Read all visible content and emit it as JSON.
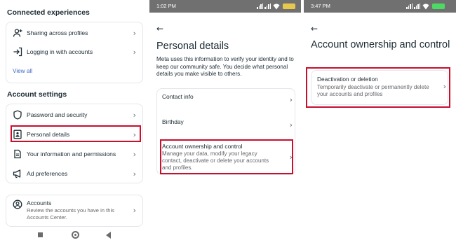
{
  "panel1": {
    "connected_heading": "Connected experiences",
    "connected_items": [
      {
        "label": "Sharing across profiles",
        "icon": "person-add-icon"
      },
      {
        "label": "Logging in with accounts",
        "icon": "login-arrow-icon"
      }
    ],
    "view_all": "View all",
    "settings_heading": "Account settings",
    "settings_items": [
      {
        "label": "Password and security",
        "icon": "shield-icon"
      },
      {
        "label": "Personal details",
        "icon": "id-card-icon",
        "highlighted": true
      },
      {
        "label": "Your information and permissions",
        "icon": "document-icon"
      },
      {
        "label": "Ad preferences",
        "icon": "megaphone-icon"
      }
    ],
    "accounts": {
      "title": "Accounts",
      "description": "Review the accounts you have in this Accounts Center.",
      "icon": "account-circle-icon"
    },
    "chevron": "›"
  },
  "panel2": {
    "time": "1:02 PM",
    "back": "←",
    "title": "Personal details",
    "description": "Meta uses this information to verify your identity and to keep our community safe. You decide what personal details you make visible to others.",
    "items": [
      {
        "label": "Contact info"
      },
      {
        "label": "Birthday"
      },
      {
        "label": "Account ownership and control",
        "sub": "Manage your data, modify your legacy contact, deactivate or delete your accounts and profiles.",
        "highlighted": true
      }
    ],
    "chevron": "›"
  },
  "panel3": {
    "time": "3:47 PM",
    "back": "←",
    "title": "Account ownership and control",
    "item": {
      "label": "Deactivation or deletion",
      "sub": "Temporarily deactivate or permanently delete your accounts and profiles",
      "highlighted": true
    },
    "chevron": "›"
  },
  "colors": {
    "highlight": "#c8102e",
    "link": "#3b66c4",
    "status_bar": "#707070",
    "battery_p2": "#e8c84a",
    "battery_p3": "#4cd964"
  }
}
